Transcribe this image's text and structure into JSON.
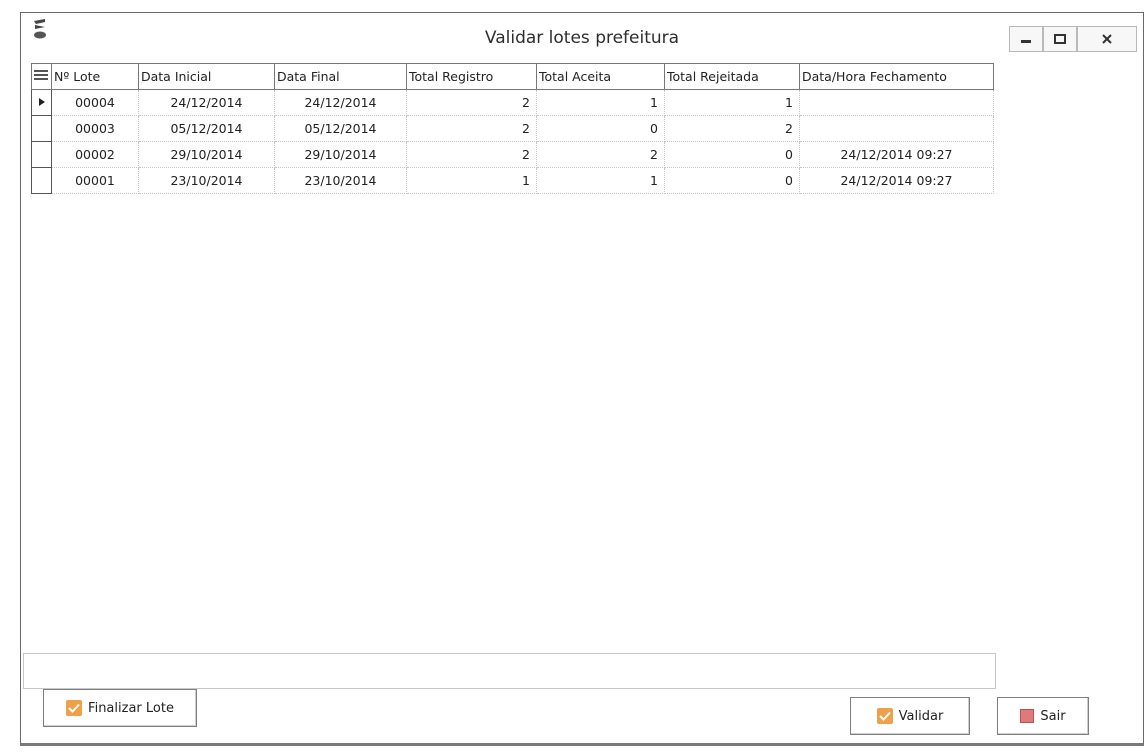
{
  "window": {
    "title": "Validar lotes prefeitura"
  },
  "grid": {
    "columns": [
      "Nº Lote",
      "Data Inicial",
      "Data Final",
      "Total Registro",
      "Total Aceita",
      "Total Rejeitada",
      "Data/Hora Fechamento"
    ],
    "rows": [
      {
        "lote": "00004",
        "data_inicial": "24/12/2014",
        "data_final": "24/12/2014",
        "total_registro": "2",
        "total_aceita": "1",
        "total_rejeitada": "1",
        "fechamento": ""
      },
      {
        "lote": "00003",
        "data_inicial": "05/12/2014",
        "data_final": "05/12/2014",
        "total_registro": "2",
        "total_aceita": "0",
        "total_rejeitada": "2",
        "fechamento": ""
      },
      {
        "lote": "00002",
        "data_inicial": "29/10/2014",
        "data_final": "29/10/2014",
        "total_registro": "2",
        "total_aceita": "2",
        "total_rejeitada": "0",
        "fechamento": "24/12/2014 09:27"
      },
      {
        "lote": "00001",
        "data_inicial": "23/10/2014",
        "data_final": "23/10/2014",
        "total_registro": "1",
        "total_aceita": "1",
        "total_rejeitada": "0",
        "fechamento": "24/12/2014 09:27"
      }
    ],
    "selected_row": 0
  },
  "buttons": {
    "finalizar": "Finalizar Lote",
    "validar": "Validar",
    "sair": "Sair"
  },
  "icons": {
    "app": "app-logo-icon",
    "minimize": "minimize-icon",
    "maximize": "maximize-icon",
    "close": "close-icon",
    "grid_corner": "grid-menu-icon",
    "row_pointer": "row-pointer-icon",
    "finalizar": "check-icon",
    "validar": "check-icon",
    "sair": "exit-icon"
  },
  "colors": {
    "button_icon": "#f0a048",
    "exit_icon": "#e07a7a"
  }
}
